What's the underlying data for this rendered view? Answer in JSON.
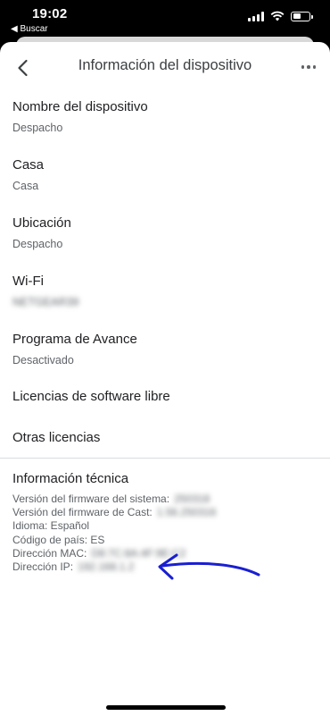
{
  "status_bar": {
    "time": "19:02",
    "back_app": "◀ Buscar"
  },
  "app_bar": {
    "title": "Información del dispositivo"
  },
  "items": [
    {
      "title": "Nombre del dispositivo",
      "subtitle": "Despacho",
      "blurred": false
    },
    {
      "title": "Casa",
      "subtitle": "Casa",
      "blurred": false
    },
    {
      "title": "Ubicación",
      "subtitle": "Despacho",
      "blurred": false
    },
    {
      "title": "Wi-Fi",
      "subtitle": "NETGEAR39",
      "blurred": true
    },
    {
      "title": "Programa de Avance",
      "subtitle": "Desactivado",
      "blurred": false
    },
    {
      "title": "Licencias de software libre"
    },
    {
      "title": "Otras licencias"
    }
  ],
  "tech": {
    "title": "Información técnica",
    "lines": [
      {
        "label": "Versión del firmware del sistema:",
        "value": "250318"
      },
      {
        "label": "Versión del firmware de Cast:",
        "value": "1.56.250316"
      },
      {
        "label": "Idioma: Español",
        "value": ""
      },
      {
        "label": "Código de país: ES",
        "value": ""
      },
      {
        "label": "Dirección MAC:",
        "value": "D8:7C:8A:4F:9E:C2"
      },
      {
        "label": "Dirección IP:",
        "value": "192.168.1.2"
      }
    ]
  },
  "colors": {
    "annotation_arrow": "#1a1fd1",
    "text_primary": "#202124",
    "text_secondary": "#5f6368"
  }
}
